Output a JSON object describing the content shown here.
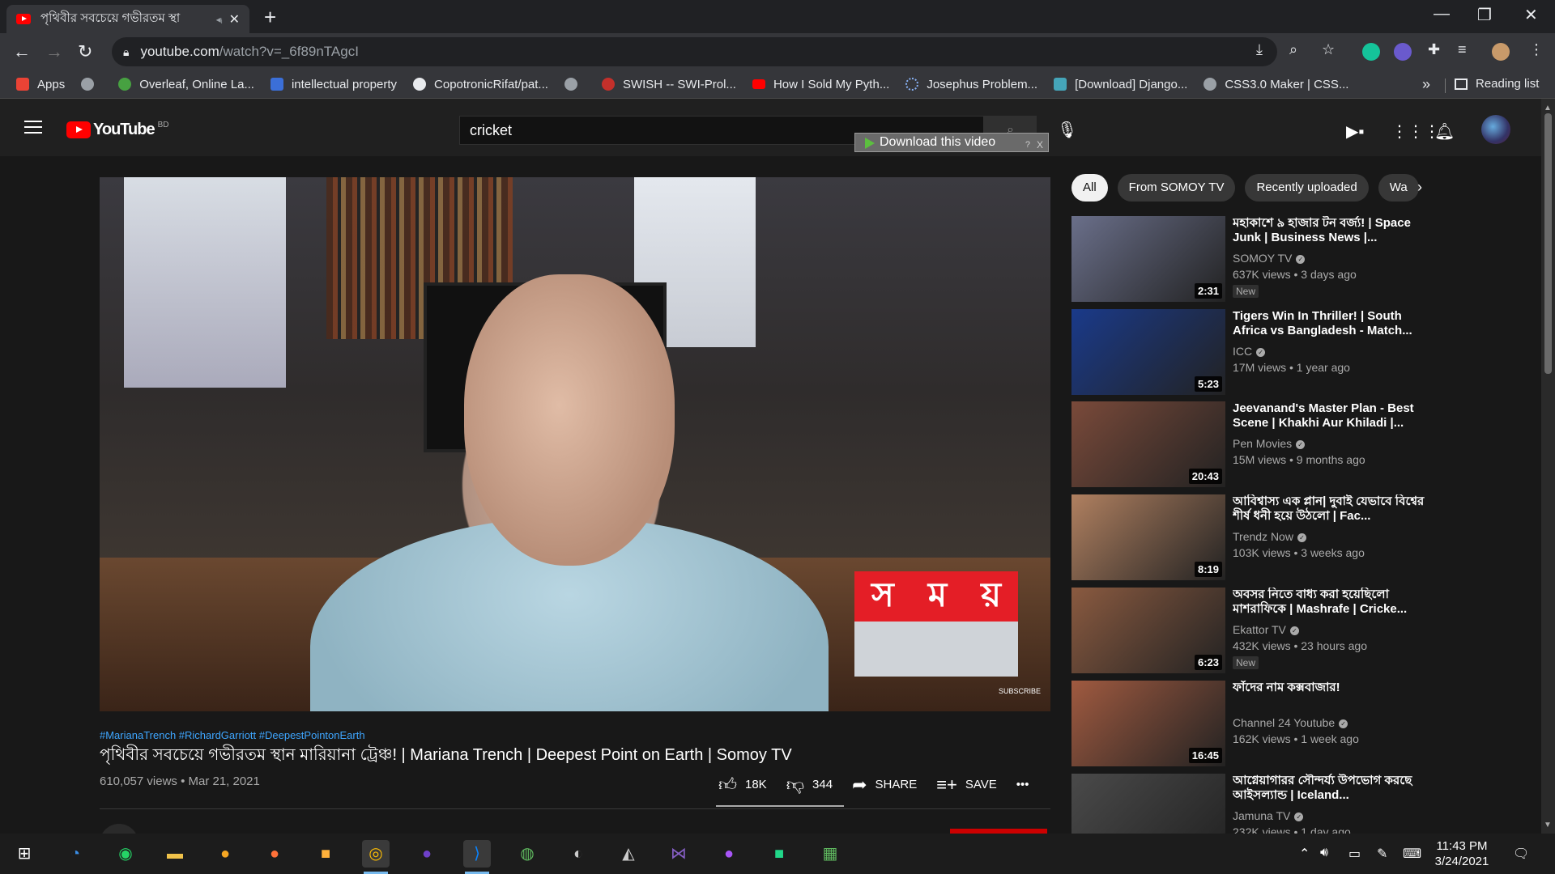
{
  "browser": {
    "tab_title": "পৃথিবীর সবচেয়ে গভীরতম স্থা",
    "url_host": "youtube.com",
    "url_path": "/watch?v=_6f89nTAgcI",
    "bookmarks": [
      {
        "label": "Apps",
        "color": "#ea4335"
      },
      {
        "label": "",
        "color": "#9aa0a6"
      },
      {
        "label": "Overleaf, Online La...",
        "color": "#47a141"
      },
      {
        "label": "intellectual property",
        "color": "#3b6fd8"
      },
      {
        "label": "CopotronicRifat/pat...",
        "color": "#e8eaed"
      },
      {
        "label": "",
        "color": "#9aa0a6"
      },
      {
        "label": "SWISH -- SWI-Prol...",
        "color": "#c4302b"
      },
      {
        "label": "How I Sold My Pyth...",
        "color": "#ff0000"
      },
      {
        "label": "Josephus Problem...",
        "color": "#8ab4f8"
      },
      {
        "label": "[Download] Django...",
        "color": "#45a5b9"
      },
      {
        "label": "CSS3.0 Maker | CSS...",
        "color": "#9aa0a6"
      }
    ],
    "reading_list": "Reading list",
    "more": "»"
  },
  "masthead": {
    "logo_text": "YouTube",
    "country": "BD",
    "search_value": "cricket",
    "download_overlay": "Download this video",
    "download_help": "?",
    "download_close": "X"
  },
  "video": {
    "logo_letters": [
      "স",
      "ম",
      "য়"
    ],
    "subscribe_tag": "SUBSCRIBE",
    "hashtags": "#MarianaTrench #RichardGarriott #DeepestPointonEarth",
    "title": "পৃথিবীর সবচেয়ে গভীরতম স্থান মারিয়ানা ট্রেঞ্চ! | Mariana Trench | Deepest Point on Earth | Somoy TV",
    "meta": "610,057 views • Mar 21, 2021",
    "likes": "18K",
    "dislikes": "344",
    "share": "SHARE",
    "save": "SAVE",
    "more": "•••"
  },
  "chips": [
    "All",
    "From SOMOY TV",
    "Recently uploaded",
    "Wa"
  ],
  "recommendations": [
    {
      "title": "মহাকাশে ৯ হাজার টন বর্জ্য! | Space Junk | Business News |...",
      "channel": "SOMOY TV",
      "views": "637K views • 3 days ago",
      "duration": "2:31",
      "badge": "New",
      "thumb": "#6a6f8a"
    },
    {
      "title": "Tigers Win In Thriller! | South Africa vs Bangladesh - Match...",
      "channel": "ICC",
      "views": "17M views • 1 year ago",
      "duration": "5:23",
      "badge": "",
      "thumb": "#1a3a8a"
    },
    {
      "title": "Jeevanand's Master Plan - Best Scene | Khakhi Aur Khiladi |...",
      "channel": "Pen Movies",
      "views": "15M views • 9 months ago",
      "duration": "20:43",
      "badge": "",
      "thumb": "#7a4a3a"
    },
    {
      "title": "আবিশ্বাস্য এক প্লান| দুবাই যেভাবে বিশ্বের শীর্ষ ধনী হয়ে উঠলো | Fac...",
      "channel": "Trendz Now",
      "views": "103K views • 3 weeks ago",
      "duration": "8:19",
      "badge": "",
      "thumb": "#b08060"
    },
    {
      "title": "অবসর নিতে বাধ্য করা হয়েছিলো মাশরাফিকে | Mashrafe | Cricke...",
      "channel": "Ekattor TV",
      "views": "432K views • 23 hours ago",
      "duration": "6:23",
      "badge": "New",
      "thumb": "#8a5a40"
    },
    {
      "title": "ফাঁদের নাম কক্সবাজার!",
      "channel": "Channel 24 Youtube",
      "views": "162K views • 1 week ago",
      "duration": "16:45",
      "badge": "",
      "thumb": "#a05a40"
    },
    {
      "title": "আগ্নেয়াগারর সৌন্দর্য্য উপভোগ করছে আইসল্যান্ড | Iceland...",
      "channel": "Jamuna TV",
      "views": "232K views • 1 day ago",
      "duration": "",
      "badge": "",
      "thumb": "#4a4a4a"
    }
  ],
  "taskbar": {
    "time": "11:43 PM",
    "date": "3/24/2021"
  }
}
